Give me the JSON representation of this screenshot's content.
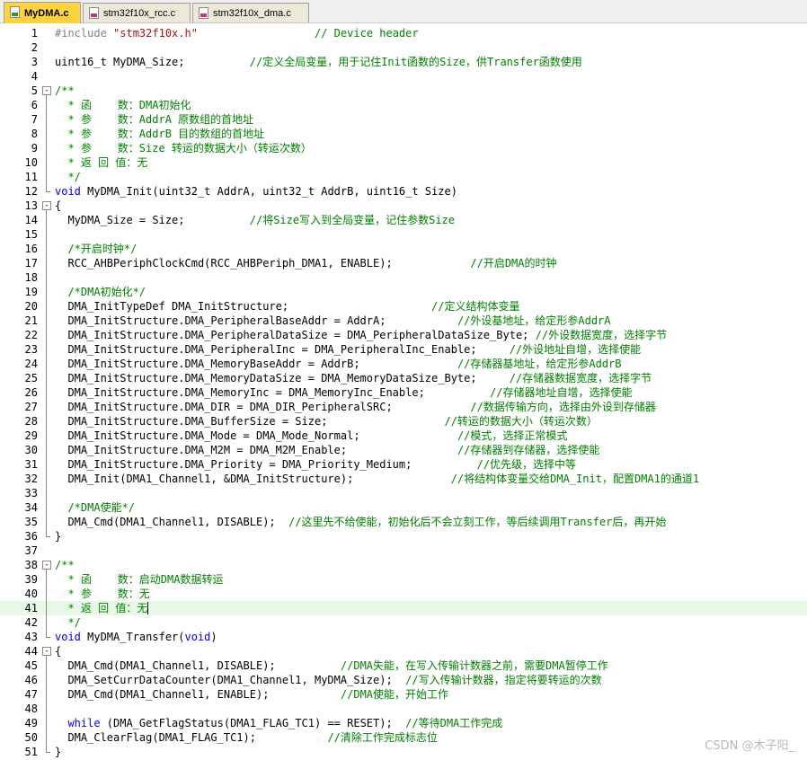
{
  "tabs": [
    {
      "label": "MyDMA.c",
      "active": true,
      "kind": "c-file-icon"
    },
    {
      "label": "stm32f10x_rcc.c",
      "active": false,
      "kind": "c-file-icon"
    },
    {
      "label": "stm32f10x_dma.c",
      "active": false,
      "kind": "c-file-icon"
    }
  ],
  "lines": [
    {
      "n": "1",
      "segs": [
        [
          "pp",
          "#include "
        ],
        [
          "str",
          "\"stm32f10x.h\""
        ],
        [
          "cm",
          "                  // Device header"
        ]
      ]
    },
    {
      "n": "2",
      "segs": []
    },
    {
      "n": "3",
      "segs": [
        [
          "n",
          "uint16_t MyDMA_Size;          "
        ],
        [
          "cm",
          "//定义全局变量，用于记住Init函数的Size，供Transfer函数使用"
        ]
      ]
    },
    {
      "n": "4",
      "segs": []
    },
    {
      "n": "5",
      "fold": "-",
      "segs": [
        [
          "cm",
          "/**"
        ]
      ]
    },
    {
      "n": "6",
      "segs": [
        [
          "cm",
          "  * 函    数：DMA初始化"
        ]
      ]
    },
    {
      "n": "7",
      "segs": [
        [
          "cm",
          "  * 参    数：AddrA 原数组的首地址"
        ]
      ]
    },
    {
      "n": "8",
      "segs": [
        [
          "cm",
          "  * 参    数：AddrB 目的数组的首地址"
        ]
      ]
    },
    {
      "n": "9",
      "segs": [
        [
          "cm",
          "  * 参    数：Size 转运的数据大小（转运次数）"
        ]
      ]
    },
    {
      "n": "10",
      "segs": [
        [
          "cm",
          "  * 返 回 值：无"
        ]
      ]
    },
    {
      "n": "11",
      "segs": [
        [
          "cm",
          "  */"
        ]
      ]
    },
    {
      "n": "12",
      "segs": [
        [
          "kw",
          "void"
        ],
        [
          "n",
          " MyDMA_Init(uint32_t AddrA, uint32_t AddrB, uint16_t Size)"
        ]
      ]
    },
    {
      "n": "13",
      "fold": "-",
      "segs": [
        [
          "n",
          "{"
        ]
      ]
    },
    {
      "n": "14",
      "segs": [
        [
          "n",
          "  MyDMA_Size = Size;          "
        ],
        [
          "cm",
          "//将Size写入到全局变量，记住参数Size"
        ]
      ]
    },
    {
      "n": "15",
      "segs": []
    },
    {
      "n": "16",
      "segs": [
        [
          "cm",
          "  /*开启时钟*/"
        ]
      ]
    },
    {
      "n": "17",
      "segs": [
        [
          "n",
          "  RCC_AHBPeriphClockCmd(RCC_AHBPeriph_DMA1, ENABLE);            "
        ],
        [
          "cm",
          "//开启DMA的时钟"
        ]
      ]
    },
    {
      "n": "18",
      "segs": []
    },
    {
      "n": "19",
      "segs": [
        [
          "cm",
          "  /*DMA初始化*/"
        ]
      ]
    },
    {
      "n": "20",
      "segs": [
        [
          "n",
          "  DMA_InitTypeDef DMA_InitStructure;                      "
        ],
        [
          "cm",
          "//定义结构体变量"
        ]
      ]
    },
    {
      "n": "21",
      "segs": [
        [
          "n",
          "  DMA_InitStructure.DMA_PeripheralBaseAddr = AddrA;           "
        ],
        [
          "cm",
          "//外设基地址，给定形参AddrA"
        ]
      ]
    },
    {
      "n": "22",
      "segs": [
        [
          "n",
          "  DMA_InitStructure.DMA_PeripheralDataSize = DMA_PeripheralDataSize_Byte; "
        ],
        [
          "cm",
          "//外设数据宽度，选择字节"
        ]
      ]
    },
    {
      "n": "23",
      "segs": [
        [
          "n",
          "  DMA_InitStructure.DMA_PeripheralInc = DMA_PeripheralInc_Enable;     "
        ],
        [
          "cm",
          "//外设地址自增，选择使能"
        ]
      ]
    },
    {
      "n": "24",
      "segs": [
        [
          "n",
          "  DMA_InitStructure.DMA_MemoryBaseAddr = AddrB;               "
        ],
        [
          "cm",
          "//存储器基地址，给定形参AddrB"
        ]
      ]
    },
    {
      "n": "25",
      "segs": [
        [
          "n",
          "  DMA_InitStructure.DMA_MemoryDataSize = DMA_MemoryDataSize_Byte;     "
        ],
        [
          "cm",
          "//存储器数据宽度，选择字节"
        ]
      ]
    },
    {
      "n": "26",
      "segs": [
        [
          "n",
          "  DMA_InitStructure.DMA_MemoryInc = DMA_MemoryInc_Enable;          "
        ],
        [
          "cm",
          "//存储器地址自增，选择使能"
        ]
      ]
    },
    {
      "n": "27",
      "segs": [
        [
          "n",
          "  DMA_InitStructure.DMA_DIR = DMA_DIR_PeripheralSRC;            "
        ],
        [
          "cm",
          "//数据传输方向，选择由外设到存储器"
        ]
      ]
    },
    {
      "n": "28",
      "segs": [
        [
          "n",
          "  DMA_InitStructure.DMA_BufferSize = Size;                  "
        ],
        [
          "cm",
          "//转运的数据大小（转运次数）"
        ]
      ]
    },
    {
      "n": "29",
      "segs": [
        [
          "n",
          "  DMA_InitStructure.DMA_Mode = DMA_Mode_Normal;               "
        ],
        [
          "cm",
          "//模式，选择正常模式"
        ]
      ]
    },
    {
      "n": "30",
      "segs": [
        [
          "n",
          "  DMA_InitStructure.DMA_M2M = DMA_M2M_Enable;                 "
        ],
        [
          "cm",
          "//存储器到存储器，选择使能"
        ]
      ]
    },
    {
      "n": "31",
      "segs": [
        [
          "n",
          "  DMA_InitStructure.DMA_Priority = DMA_Priority_Medium;          "
        ],
        [
          "cm",
          "//优先级，选择中等"
        ]
      ]
    },
    {
      "n": "32",
      "segs": [
        [
          "n",
          "  DMA_Init(DMA1_Channel1, &DMA_InitStructure);               "
        ],
        [
          "cm",
          "//将结构体变量交给DMA_Init，配置DMA1的通道1"
        ]
      ]
    },
    {
      "n": "33",
      "segs": []
    },
    {
      "n": "34",
      "segs": [
        [
          "cm",
          "  /*DMA使能*/"
        ]
      ]
    },
    {
      "n": "35",
      "segs": [
        [
          "n",
          "  DMA_Cmd(DMA1_Channel1, DISABLE);  "
        ],
        [
          "cm",
          "//这里先不给使能，初始化后不会立刻工作，等后续调用Transfer后，再开始"
        ]
      ]
    },
    {
      "n": "36",
      "segs": [
        [
          "n",
          "}"
        ]
      ]
    },
    {
      "n": "37",
      "segs": []
    },
    {
      "n": "38",
      "fold": "-",
      "segs": [
        [
          "cm",
          "/**"
        ]
      ]
    },
    {
      "n": "39",
      "segs": [
        [
          "cm",
          "  * 函    数：启动DMA数据转运"
        ]
      ]
    },
    {
      "n": "40",
      "segs": [
        [
          "cm",
          "  * 参    数：无"
        ]
      ]
    },
    {
      "n": "41",
      "hl": true,
      "cursor": true,
      "segs": [
        [
          "cm",
          "  * 返 回 值：无"
        ]
      ]
    },
    {
      "n": "42",
      "segs": [
        [
          "cm",
          "  */"
        ]
      ]
    },
    {
      "n": "43",
      "segs": [
        [
          "kw",
          "void"
        ],
        [
          "n",
          " MyDMA_Transfer("
        ],
        [
          "kw",
          "void"
        ],
        [
          "n",
          ")"
        ]
      ]
    },
    {
      "n": "44",
      "fold": "-",
      "segs": [
        [
          "n",
          "{"
        ]
      ]
    },
    {
      "n": "45",
      "segs": [
        [
          "n",
          "  DMA_Cmd(DMA1_Channel1, DISABLE);          "
        ],
        [
          "cm",
          "//DMA失能，在写入传输计数器之前，需要DMA暂停工作"
        ]
      ]
    },
    {
      "n": "46",
      "segs": [
        [
          "n",
          "  DMA_SetCurrDataCounter(DMA1_Channel1, MyDMA_Size);  "
        ],
        [
          "cm",
          "//写入传输计数器，指定将要转运的次数"
        ]
      ]
    },
    {
      "n": "47",
      "segs": [
        [
          "n",
          "  DMA_Cmd(DMA1_Channel1, ENABLE);           "
        ],
        [
          "cm",
          "//DMA使能，开始工作"
        ]
      ]
    },
    {
      "n": "48",
      "segs": []
    },
    {
      "n": "49",
      "segs": [
        [
          "n",
          "  "
        ],
        [
          "kw",
          "while"
        ],
        [
          "n",
          " (DMA_GetFlagStatus(DMA1_FLAG_TC1) == RESET);  "
        ],
        [
          "cm",
          "//等待DMA工作完成"
        ]
      ]
    },
    {
      "n": "50",
      "segs": [
        [
          "n",
          "  DMA_ClearFlag(DMA1_FLAG_TC1);           "
        ],
        [
          "cm",
          "//清除工作完成标志位"
        ]
      ]
    },
    {
      "n": "51",
      "segs": [
        [
          "n",
          "}"
        ]
      ]
    }
  ],
  "watermark": "CSDN @木子阳_",
  "colors": {
    "comment": "#008000",
    "keyword": "#0000ff",
    "string": "#a31515",
    "preprocessor": "#808080",
    "active_tab": "#ffd23f",
    "current_line": "#e8f8e6"
  }
}
